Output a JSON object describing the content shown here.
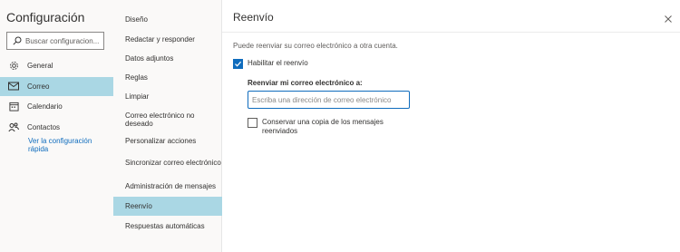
{
  "settings": {
    "title": "Configuración",
    "search_placeholder": "Buscar configuracion..."
  },
  "nav": {
    "items": [
      {
        "label": "General",
        "icon": "gear-icon"
      },
      {
        "label": "Correo",
        "icon": "mail-icon",
        "active": true
      },
      {
        "label": "Calendario",
        "icon": "calendar-icon"
      },
      {
        "label": "Contactos",
        "icon": "people-icon"
      }
    ],
    "quick_link": "Ver la configuración rápida"
  },
  "subnav": {
    "items": [
      "Diseño",
      "Redactar y responder",
      "Datos adjuntos",
      "Reglas",
      "Limpiar",
      "Correo electrónico no deseado",
      "Personalizar acciones",
      "Sincronizar correo electrónico",
      "Administración de mensajes",
      "Reenvío",
      "Respuestas automáticas"
    ],
    "active": "Reenvío"
  },
  "forwarding": {
    "title": "Reenvío",
    "description": "Puede reenviar su correo electrónico a otra cuenta.",
    "enable_label": "Habilitar el reenvío",
    "enable_checked": true,
    "forward_to_label": "Reenviar mi correo electrónico a:",
    "email_placeholder": "Escriba una dirección de correo electrónico",
    "email_value": "",
    "keep_copy_label": "Conservar una copia de los mensajes reenviados",
    "keep_copy_checked": false
  },
  "colors": {
    "accent": "#0f6cbd",
    "selected_bg": "#aad7e4",
    "pane_bg": "#faf9f8"
  }
}
